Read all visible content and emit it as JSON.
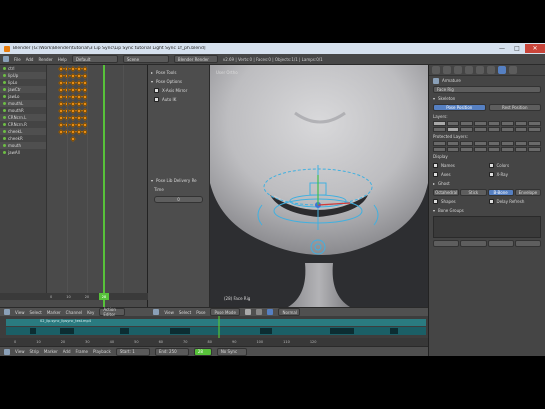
{
  "window": {
    "title": "Blender [G:\\Work\\Blender\\tutorial\\3 Lip Sync\\Lip Sync tutorial Light Sync 1f_ph.blend]",
    "minimize": "—",
    "maximize": "□",
    "close": "✕"
  },
  "infobar": {
    "menus": [
      "File",
      "Add",
      "Render",
      "Help"
    ],
    "layout": "Default",
    "scene": "Scene",
    "engine": "Blender Render",
    "stats": "v2.69 | Verts:0 | Faces:0 | Objects:1/1 | Lamps:0/1"
  },
  "dopesheet": {
    "channels": [
      "ctrl",
      "lipUp",
      "lipLo",
      "jawCtr",
      "jawLo",
      "mouthL",
      "mouthR",
      "CRNcrn.L",
      "CRNcrn.R",
      "cheekL",
      "cheekR",
      "mouth",
      "jawAll"
    ],
    "ruler": [
      "0",
      "10",
      "20",
      "30"
    ],
    "current_frame": "28"
  },
  "toolshelf": {
    "pose_tools": "Pose Tools",
    "pose_options": "Pose Options",
    "x_axis_mirror": "X-Axis Mirror",
    "auto_ik": "Auto IK",
    "add_delete": "Pose Lib Delivery Re",
    "frame_label": "Time",
    "frame_value": "0"
  },
  "viewport": {
    "label": "User Ortho",
    "object": "(28) Face Rig"
  },
  "properties": {
    "context_path": "Armature",
    "object_data": "Face Rig",
    "skeleton_header": "Skeleton",
    "pose_position": "Pose Position",
    "rest_position": "Rest Position",
    "layers": "Layers:",
    "protected_layers": "Protected Layers:",
    "display": "Display",
    "octahedral": "Octahedral",
    "stick": "Stick",
    "bbone": "B-Bone",
    "envelope": "Envelope",
    "wire": "Wire",
    "names": "Names",
    "colors": "Colors",
    "axes": "Axes",
    "xray": "X-Ray",
    "shapes": "Shapes",
    "delay_refresh": "Delay Refresh",
    "bone_groups": "Bone Groups",
    "ghost": "Ghost",
    "inverse_kinematics": "Inverse Kinematics",
    "motion_paths": "Motion Paths",
    "bone_groups_panel": "Bone Groups"
  },
  "viewheader": {
    "items": [
      "View",
      "Select",
      "Pose",
      "Pose Mode",
      "Normal"
    ],
    "dope_items": [
      "View",
      "Select",
      "Marker",
      "Channel",
      "Key",
      "Action Editor"
    ]
  },
  "nla": {
    "strip_label": "02_lip.sync_lipsync_test.mp4",
    "ruler": [
      "0",
      "10",
      "20",
      "30",
      "40",
      "50",
      "60",
      "70",
      "80",
      "90",
      "100",
      "110",
      "120"
    ]
  },
  "timeline": {
    "items": [
      "View",
      "Strip",
      "Marker",
      "Add",
      "Frame",
      "Playback"
    ],
    "start": "Start: 1",
    "end": "End: 250",
    "frame": "28",
    "no_sync": "No Sync"
  },
  "colors": {
    "key": "#ff9c1e",
    "current_frame": "#57c23a",
    "accent": "#5680c2",
    "rig_lines": "#40b0e0"
  }
}
